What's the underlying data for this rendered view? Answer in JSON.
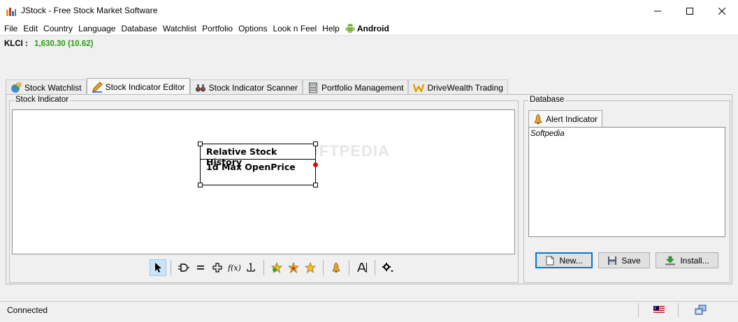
{
  "window": {
    "title": "JStock - Free Stock Market Software"
  },
  "menu": {
    "items": [
      "File",
      "Edit",
      "Country",
      "Language",
      "Database",
      "Watchlist",
      "Portfolio",
      "Options",
      "Look n Feel",
      "Help"
    ],
    "android_label": "Android"
  },
  "index": {
    "label": "KLCI :",
    "value": "1,630.30 (10.62)",
    "value_color": "#2e9a17"
  },
  "tabs": [
    {
      "label": "Stock Watchlist",
      "icon": "globe-icon"
    },
    {
      "label": "Stock Indicator Editor",
      "icon": "pencil-icon",
      "active": true
    },
    {
      "label": "Stock Indicator Scanner",
      "icon": "binoculars-icon"
    },
    {
      "label": "Portfolio Management",
      "icon": "calculator-icon"
    },
    {
      "label": "DriveWealth Trading",
      "icon": "drivewealth-icon"
    }
  ],
  "stock_indicator": {
    "group_title": "Stock Indicator",
    "block": {
      "title": "Relative Stock History",
      "row": "1d Max OpenPrice"
    },
    "watermark": "SOFTPEDIA"
  },
  "toolbar": {
    "tools": [
      "pointer-icon",
      "gate-icon",
      "equals-icon",
      "plus-icon",
      "function-icon",
      "one-icon",
      "star-add-icon",
      "star-icon",
      "star-gold-icon",
      "bell-icon",
      "text-icon",
      "gear-icon"
    ]
  },
  "database": {
    "group_title": "Database",
    "tab_label": "Alert Indicator",
    "items": [
      "Softpedia"
    ],
    "new_label": "New...",
    "save_label": "Save",
    "install_label": "Install..."
  },
  "status": {
    "text": "Connected"
  }
}
